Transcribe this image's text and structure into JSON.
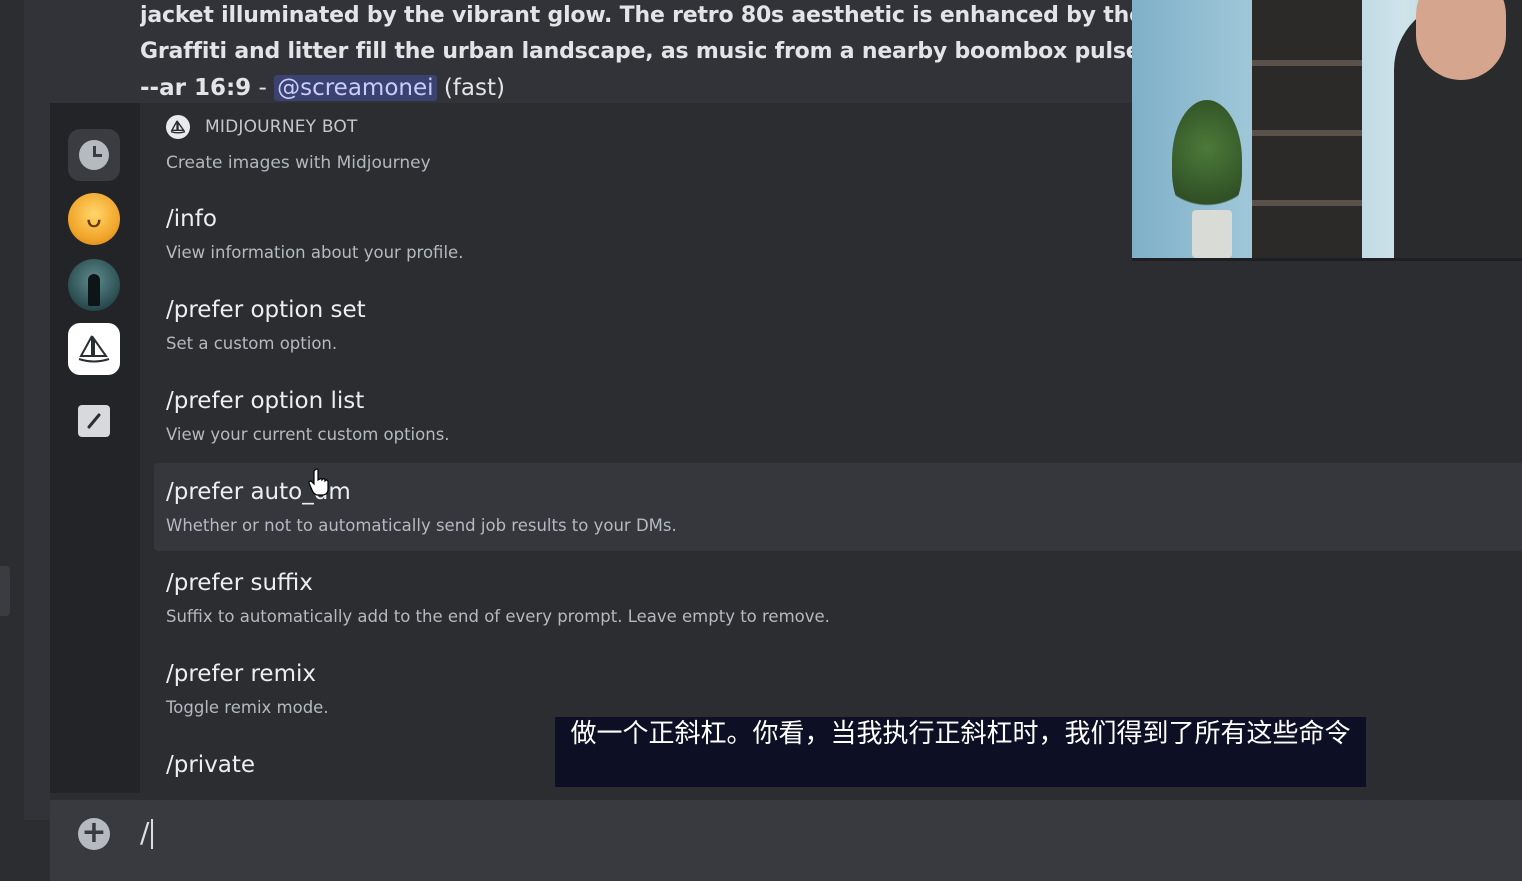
{
  "message": {
    "line1": "jacket illuminated by the vibrant glow. The retro 80s aesthetic is enhanced by the VHS-",
    "line2": "Graffiti and litter fill the urban landscape, as music from a nearby boombox pulses thro",
    "line3_prefix": "--ar 16:9",
    "line3_sep": " - ",
    "mention": "@screamonei",
    "mode": " (fast)"
  },
  "popup": {
    "bot_name": "MIDJOURNEY BOT",
    "bot_desc": "Create images with Midjourney",
    "commands": [
      {
        "name": "/info",
        "desc": "View information about your profile."
      },
      {
        "name": "/prefer option set",
        "desc": "Set a custom option."
      },
      {
        "name": "/prefer option list",
        "desc": "View your current custom options."
      },
      {
        "name": "/prefer auto_dm",
        "desc": "Whether or not to automatically send job results to your DMs."
      },
      {
        "name": "/prefer suffix",
        "desc": "Suffix to automatically add to the end of every prompt. Leave empty to remove."
      },
      {
        "name": "/prefer remix",
        "desc": "Toggle remix mode."
      },
      {
        "name": "/private",
        "desc": ""
      }
    ]
  },
  "subtitle": {
    "text": "做一个正斜杠。你看，当我执行正斜杠时，我们得到了所有这些命令"
  },
  "input": {
    "value": "/"
  },
  "colors": {
    "background": "#313338",
    "popup": "#2b2d31",
    "rail": "#232428",
    "hover_row": "#35373c",
    "mention_bg": "#3c4270",
    "subtitle_bg": "#0d1024"
  }
}
